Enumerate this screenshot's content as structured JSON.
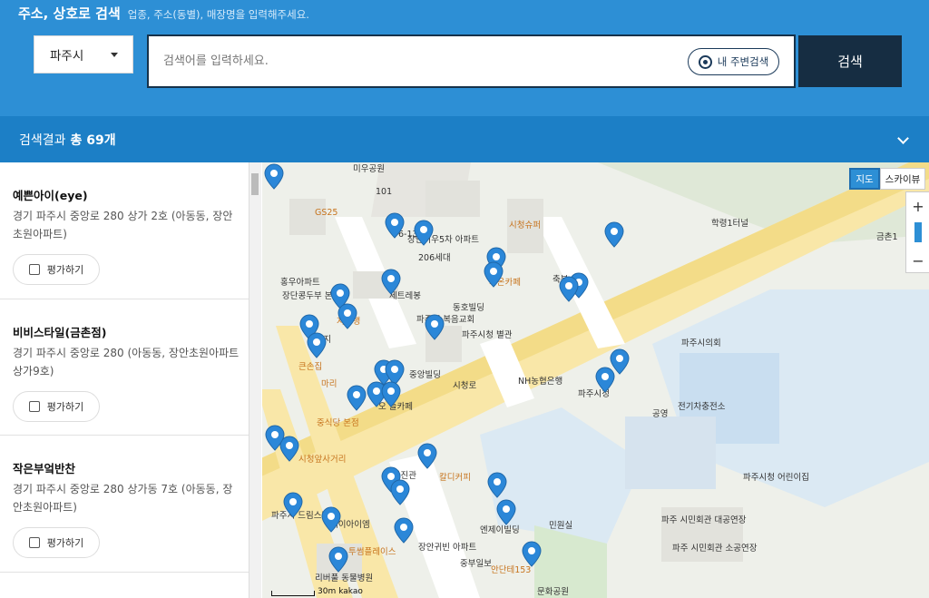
{
  "header": {
    "title": "주소, 상호로 검색",
    "subtitle": "업종, 주소(동별), 매장명을 입력해주세요.",
    "city_select": "파주시",
    "search_placeholder": "검색어를 입력하세요.",
    "nearby_label": "내 주변검색",
    "search_button": "검색"
  },
  "results": {
    "prefix": "검색결과",
    "count": "총 69개",
    "items": [
      {
        "name": "예쁜아이(eye)",
        "address": "경기 파주시 중앙로 280 상가 2호 (아동동, 장안초원아파트)",
        "rate_label": "평가하기"
      },
      {
        "name": "비비스타일(금촌점)",
        "address": "경기 파주시 중앙로 280 (아동동, 장안초원아파트상가9호)",
        "rate_label": "평가하기"
      },
      {
        "name": "작은부엌반찬",
        "address": "경기 파주시 중앙로 280 상가동 7호 (아동동, 장안초원아파트)",
        "rate_label": "평가하기"
      }
    ]
  },
  "map": {
    "type_map": "지도",
    "type_skyview": "스카이뷰",
    "zoom_in": "+",
    "zoom_out": "−",
    "scale_label": "30m",
    "brand": "kakao",
    "labels": [
      "미우공원",
      "GS25",
      "장안미우5차 아파트",
      "206세대",
      "시청슈퍼",
      "가온카페",
      "축복",
      "홍우아파트",
      "장단콩두부 본점",
      "지옥행",
      "세트레봉",
      "동호빌딩",
      "파주 순복음교회",
      "파주시청 별관",
      "빌리지",
      "큰손집",
      "중앙빌딩",
      "NH농협은행",
      "파주시청",
      "파주시의회",
      "공영",
      "전기차충전소",
      "마리",
      "오 늘카페",
      "중식당 본점",
      "시청앞사거리",
      "정사진관",
      "칼디커피",
      "파주시청 어린이집",
      "파주시 드림스타트",
      "케이아이엠",
      "엔제이빌딩",
      "민원실",
      "파주 시민회관 대공연장",
      "파주 시민회관 소공연장",
      "투썸플레이스",
      "장안귀빈 아파트",
      "중부일보",
      "안단테153",
      "리버풀 동물병원",
      "문화공원",
      "학령1터널",
      "시청로",
      "금촌1",
      "101",
      "6-13동"
    ]
  },
  "colors": {
    "header_bg": "#2d8fd5",
    "result_bar_bg": "#1c7fc6",
    "search_button_bg": "#162d42",
    "marker": "#2b87d8"
  }
}
